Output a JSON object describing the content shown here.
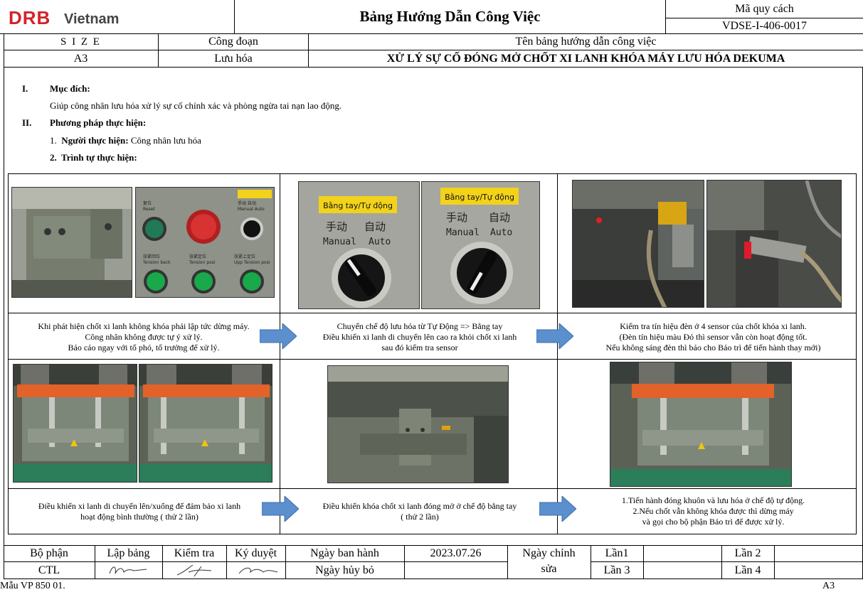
{
  "header": {
    "logo_text": "DRB",
    "logo_sub": "Vietnam",
    "title": "Bảng Hướng Dẫn Công Việc",
    "spec_label": "Mã quy cách",
    "spec_value": "VDSE-I-406-0017",
    "size_label": "S I Z E",
    "size_value": "A3",
    "stage_label": "Công đoạn",
    "stage_value": "Lưu hóa",
    "guide_label": "Tên bảng hướng dẫn công việc",
    "guide_value": "XỬ LÝ SỰ CỐ ĐÓNG MỞ CHỐT XI LANH KHÓA MÁY LƯU HÓA DEKUMA"
  },
  "body": {
    "s1_num": "I.",
    "s1_title": "Mục đích:",
    "s1_text": "Giúp công nhân lưu hóa xử lý sự cố chính xác và phòng ngừa tai nạn lao động.",
    "s2_num": "II.",
    "s2_title": "Phương pháp thực hiện:",
    "item1_num": "1.",
    "item1_label": "Người thực hiện:",
    "item1_value": "Công nhân lưu hóa",
    "item2_num": "2.",
    "item2_label": "Trình tự thực hiện:"
  },
  "photo_labels": {
    "panel_sign": "Bằng tay/Tự động",
    "cn_manual": "手动",
    "cn_auto": "自动",
    "en_manual": "Manual",
    "en_auto": "Auto",
    "btn_reset": "Reset",
    "btn_tension_back": "Tension back",
    "btn_tension_posi": "Tension posi",
    "btn_upper": "Upp Tension posi",
    "btn_manual_auto": "Manual Auto",
    "cn_reset": "复位",
    "cn_back": "张紧回位",
    "cn_posi": "张紧定位",
    "cn_upper": "张紧上定位",
    "cn_mode": "手动 自动"
  },
  "steps": {
    "step1": [
      "Khi phát hiện chốt xi lanh không khóa phải lập tức dừng máy.",
      "Công nhân không được tự ý xử lý.",
      "Báo cáo ngay với tổ phó, tổ trưởng để xử lý."
    ],
    "step2": [
      "Chuyển chế độ lưu hóa từ Tự Động => Bằng tay",
      "Điều khiển xi lanh di chuyển lên cao ra khỏi chốt xi lanh",
      "sau đó kiểm tra sensor"
    ],
    "step3": [
      "Kiểm tra tín hiệu đèn ở 4 sensor của chốt khóa xi lanh.",
      "(Đèn tín hiệu màu Đỏ thì sensor vẫn còn hoạt động tốt.",
      "Nếu không sáng đèn thì báo cho Bảo trì để tiến hành thay mới)"
    ],
    "step4": [
      "Điều khiển xi lanh di chuyển lên/xuống để đảm bảo xi lanh",
      "hoạt động bình thường ( thử 2 lần)"
    ],
    "step5": [
      "Điều khiển khóa chốt xi lanh đóng mở ở chế độ bằng tay",
      "( thử 2 lần)"
    ],
    "step6": [
      "1.Tiến hành đóng khuôn và lưu hóa ở chế độ tự động.",
      "2.Nếu chốt vẫn không khóa được thì dừng máy",
      "và gọi cho bộ phận Bảo trì để được xử lý."
    ]
  },
  "footer": {
    "dept_label": "Bộ phận",
    "prepared_label": "Lập bảng",
    "checked_label": "Kiểm tra",
    "approved_label": "Ký duyệt",
    "issue_label": "Ngày ban hành",
    "issue_date": "2023.07.26",
    "edit_label_1": "Ngày chỉnh",
    "edit_label_2": "sửa",
    "rev1": "Lần1",
    "rev2": "Lần 2",
    "rev3": "Lần 3",
    "rev4": "Lần 4",
    "dept_value": "CTL",
    "cancel_label": "Ngày hủy bỏ",
    "form_code": "Mẫu VP  850   01.",
    "paper_size": "A3"
  },
  "colors": {
    "logo_red": "#d2232a",
    "arrow_blue": "#5b8fce",
    "machine_orange": "#e3622a",
    "machine_gray": "#7d8779",
    "sign_yellow": "#f2d21a"
  }
}
